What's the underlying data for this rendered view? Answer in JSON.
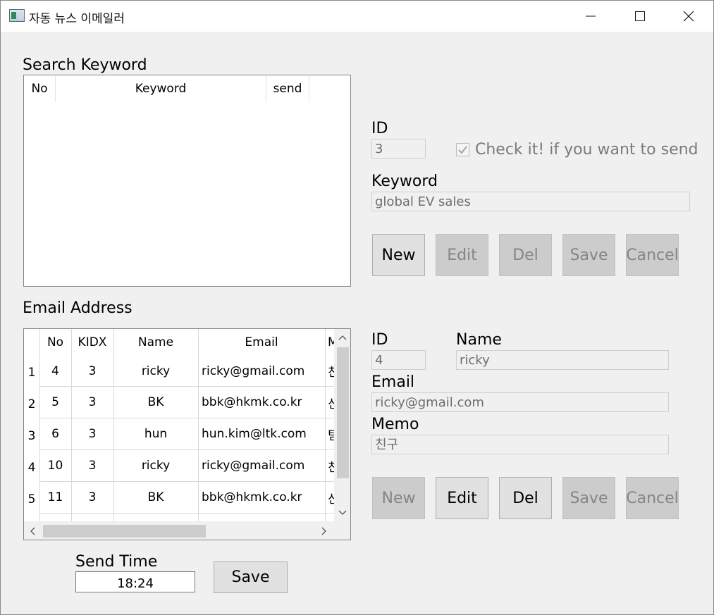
{
  "window": {
    "title": "자동 뉴스 이메일러"
  },
  "keyword_section": {
    "label": "Search Keyword",
    "columns": [
      "No",
      "Keyword",
      "send"
    ],
    "rows": []
  },
  "keyword_form": {
    "id_label": "ID",
    "id_value": "3",
    "check_label": "Check it! if you want to send",
    "checked": true,
    "keyword_label": "Keyword",
    "keyword_value": "global EV sales",
    "buttons": {
      "new": "New",
      "edit": "Edit",
      "del": "Del",
      "save": "Save",
      "cancel": "Cancel"
    }
  },
  "email_section": {
    "label": "Email Address",
    "columns": [
      "No",
      "KIDX",
      "Name",
      "Email",
      "M"
    ],
    "rows": [
      {
        "header": "1",
        "no": "4",
        "kidx": "3",
        "name": "ricky",
        "email": "ricky@gmail.com",
        "memo": "친"
      },
      {
        "header": "2",
        "no": "5",
        "kidx": "3",
        "name": "BK",
        "email": "bbk@hkmk.co.kr",
        "memo": "신"
      },
      {
        "header": "3",
        "no": "6",
        "kidx": "3",
        "name": "hun",
        "email": "hun.kim@ltk.com",
        "memo": "팀"
      },
      {
        "header": "4",
        "no": "10",
        "kidx": "3",
        "name": "ricky",
        "email": "ricky@gmail.com",
        "memo": "친"
      },
      {
        "header": "5",
        "no": "11",
        "kidx": "3",
        "name": "BK",
        "email": "bbk@hkmk.co.kr",
        "memo": "신"
      }
    ]
  },
  "email_form": {
    "id_label": "ID",
    "id_value": "4",
    "name_label": "Name",
    "name_value": "ricky",
    "email_label": "Email",
    "email_value": "ricky@gmail.com",
    "memo_label": "Memo",
    "memo_value": "친구",
    "buttons": {
      "new": "New",
      "edit": "Edit",
      "del": "Del",
      "save": "Save",
      "cancel": "Cancel"
    }
  },
  "send_time": {
    "label": "Send Time",
    "value": "18:24",
    "save": "Save"
  }
}
